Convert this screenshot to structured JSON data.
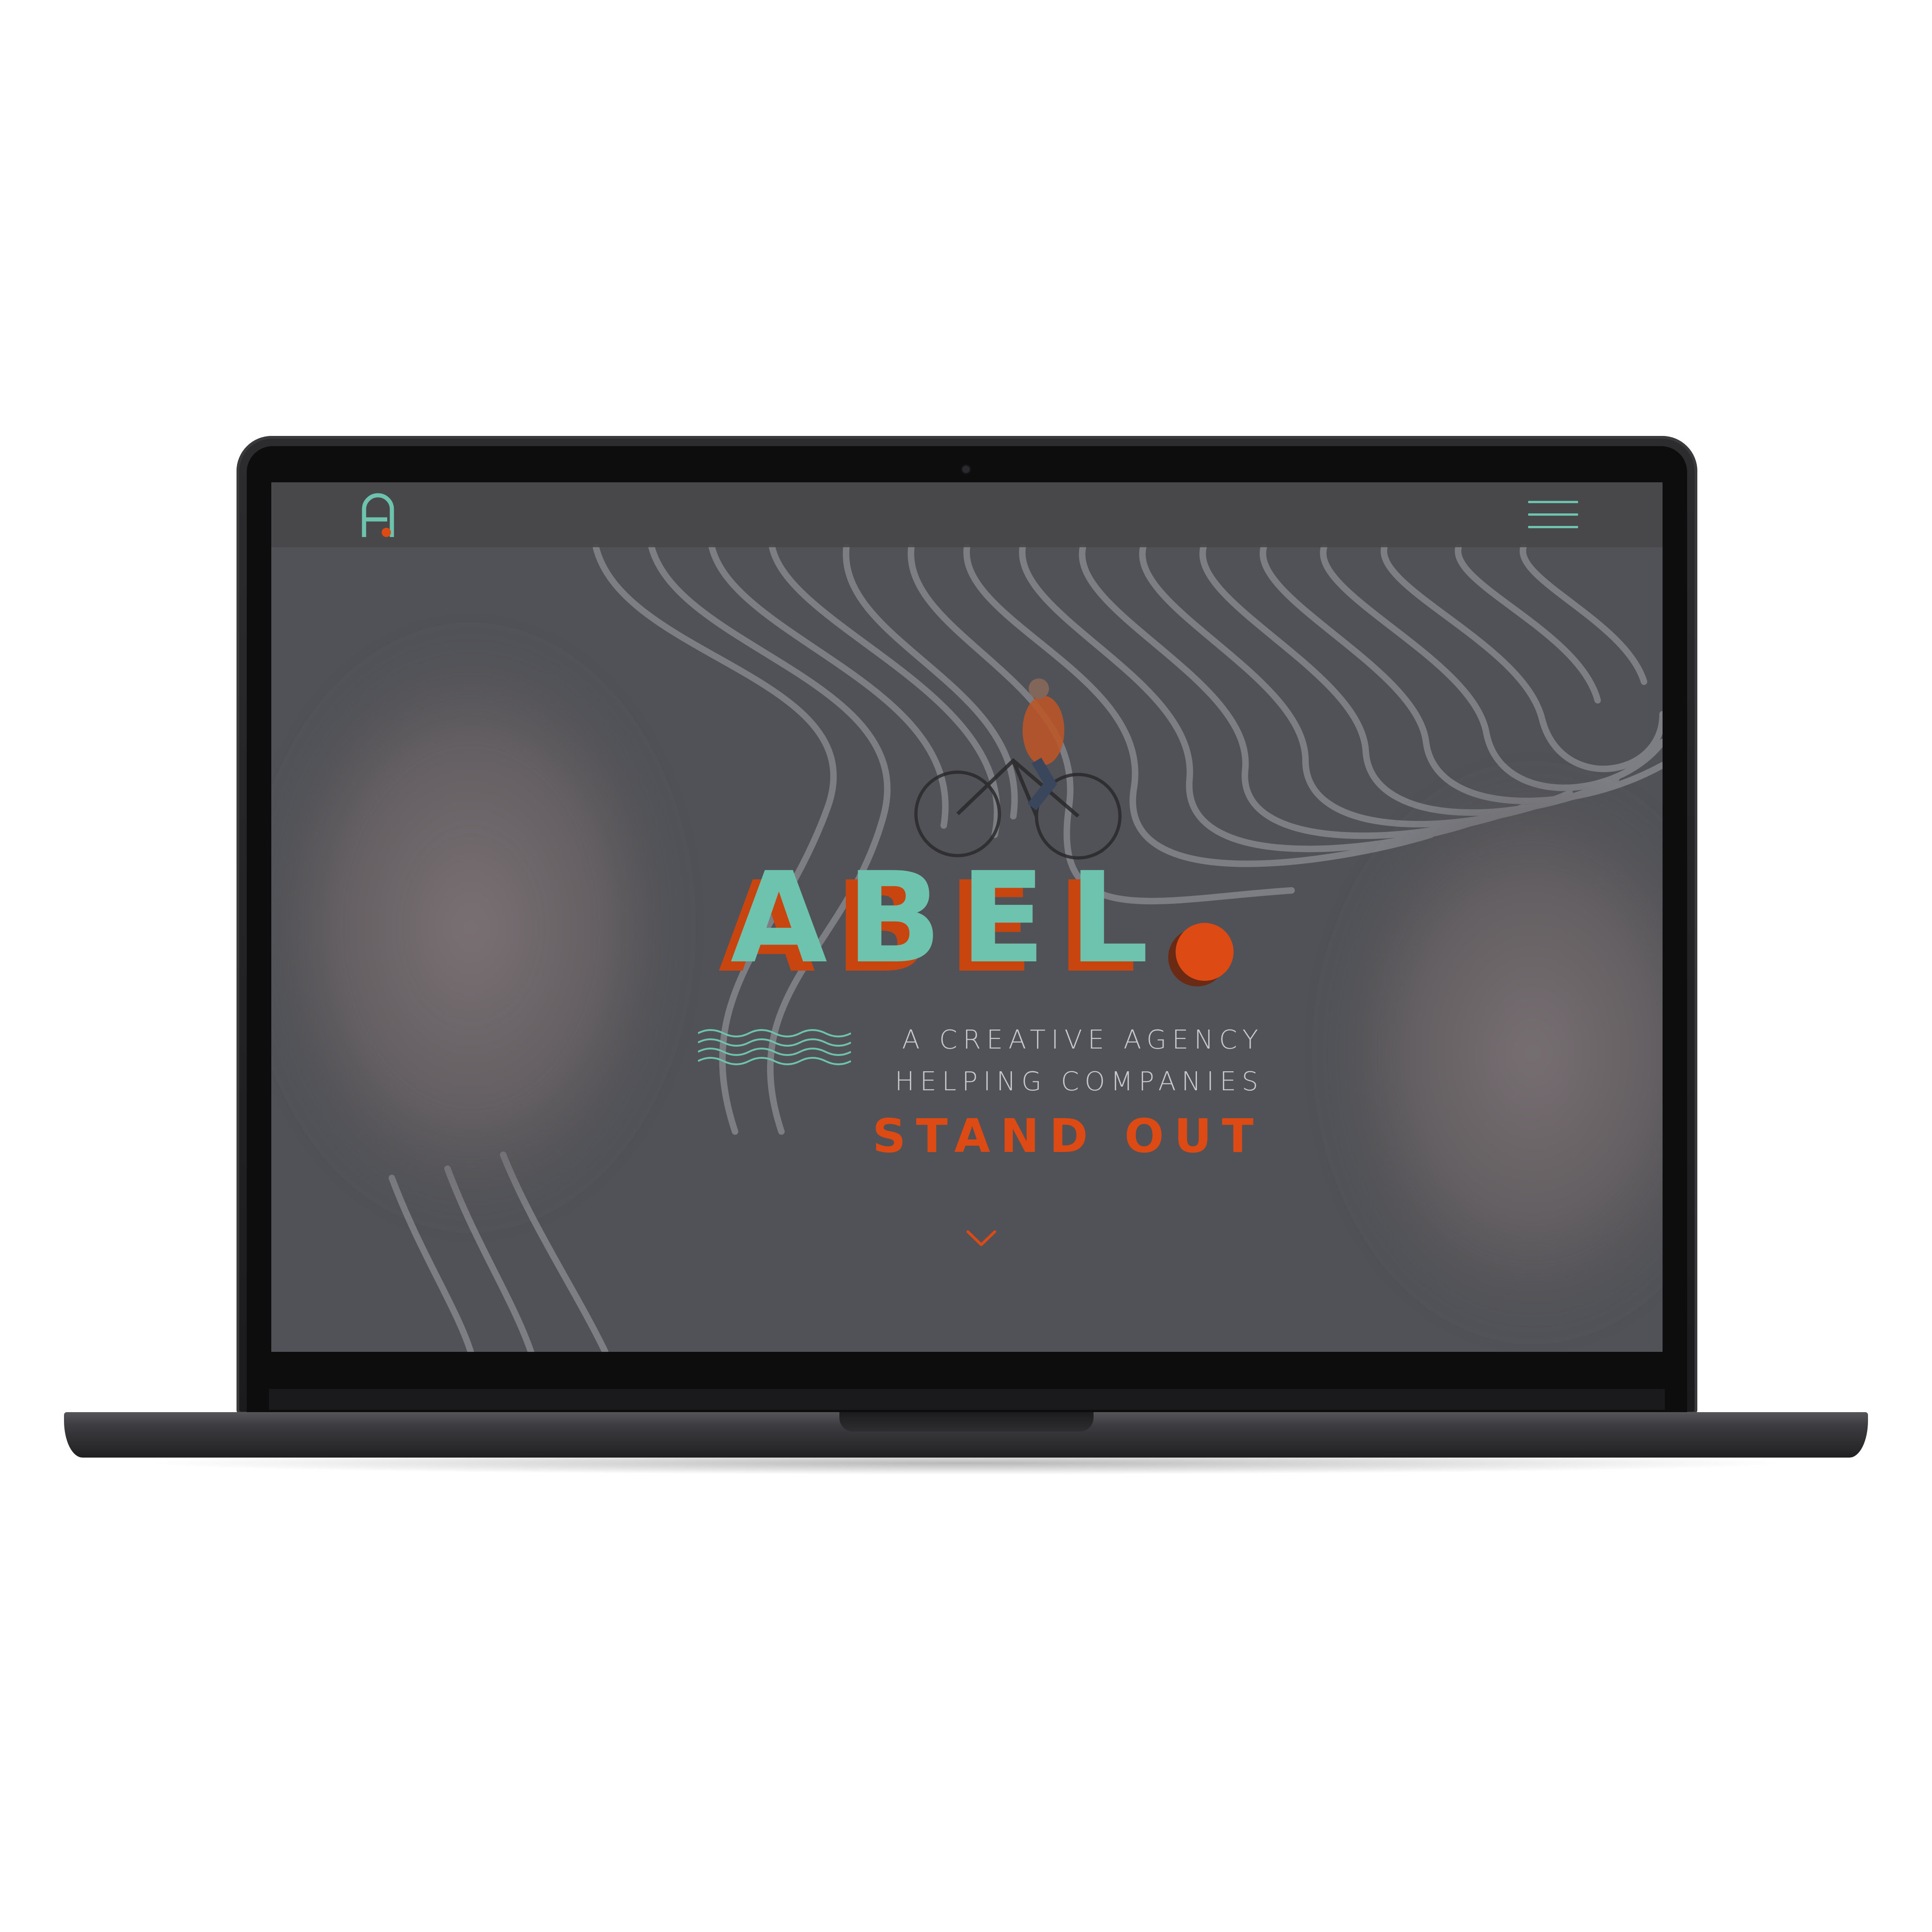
{
  "colors": {
    "mint": "#6dc3ae",
    "orange": "#de4a14",
    "shadow_red": "#b83a10",
    "topbar": "#48484a"
  },
  "header": {
    "logo_icon": "letter-a-logo-icon",
    "menu_icon": "hamburger-menu-icon"
  },
  "hero": {
    "brand_letters": [
      "A",
      "B",
      "E",
      "L"
    ],
    "tagline_line1": "A CREATIVE AGENCY",
    "tagline_line2": "HELPING COMPANIES",
    "tagline_line3": "STAND OUT",
    "waves_icon": "waves-icon",
    "scroll_icon": "chevron-down-icon"
  }
}
